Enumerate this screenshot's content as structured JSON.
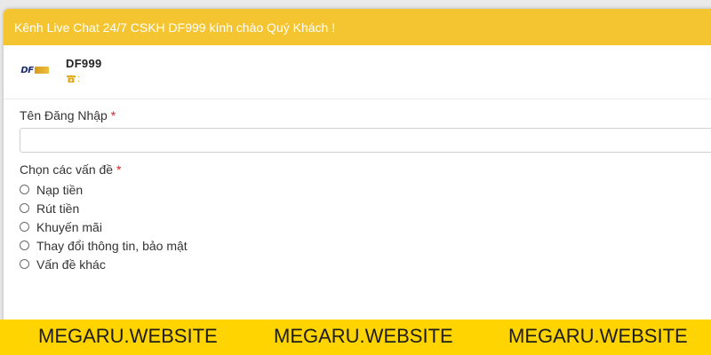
{
  "header": {
    "title": "Kênh Live Chat 24/7 CSKH DF999 kính chào Quý Khách !"
  },
  "agent": {
    "name": "DF999",
    "contact_text": ":",
    "logo_text": "DF"
  },
  "form": {
    "username_label": "Tên Đăng Nhập",
    "username_value": "",
    "issues_label": "Chọn các vấn đề",
    "required_mark": "*",
    "options": [
      {
        "label": "Nạp tiền",
        "checked": false
      },
      {
        "label": "Rút tiền",
        "checked": false
      },
      {
        "label": "Khuyến mãi",
        "checked": false
      },
      {
        "label": "Thay đổi thông tin, bảo mật",
        "checked": false
      },
      {
        "label": "Vấn đề khác",
        "checked": false
      }
    ]
  },
  "watermarks": [
    "MEGARU.WEBSITE",
    "MEGARU.WEBSITE",
    "MEGARU.WEBSITE"
  ],
  "colors": {
    "header_bg": "#f5c431",
    "accent": "#e2a91a",
    "watermark_bg": "#ffd400",
    "required": "#e02020"
  }
}
